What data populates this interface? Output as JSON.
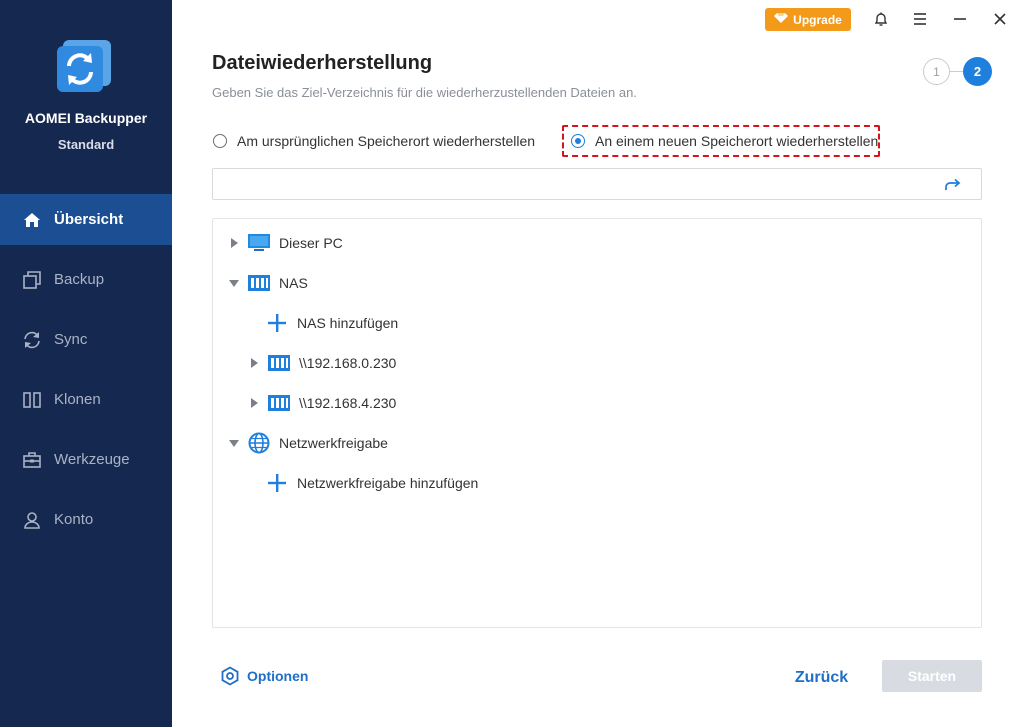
{
  "app": {
    "name": "AOMEI Backupper",
    "edition": "Standard"
  },
  "sidebar": {
    "items": [
      {
        "label": "Übersicht",
        "icon": "home-icon",
        "active": true
      },
      {
        "label": "Backup",
        "icon": "backup-icon",
        "active": false
      },
      {
        "label": "Sync",
        "icon": "sync-icon",
        "active": false
      },
      {
        "label": "Klonen",
        "icon": "clone-icon",
        "active": false
      },
      {
        "label": "Werkzeuge",
        "icon": "toolbox-icon",
        "active": false
      },
      {
        "label": "Konto",
        "icon": "user-icon",
        "active": false
      }
    ]
  },
  "titlebar": {
    "upgrade_label": "Upgrade"
  },
  "header": {
    "title": "Dateiwiederherstellung",
    "subtitle": "Geben Sie das Ziel-Verzeichnis für die wiederherzustellenden Dateien an.",
    "steps": [
      "1",
      "2"
    ],
    "current_step": 2
  },
  "restore_options": {
    "original_label": "Am ursprünglichen Speicherort wiederherstellen",
    "new_label": "An einem neuen Speicherort wiederherstellen",
    "selected": "new"
  },
  "path": {
    "value": "",
    "placeholder": ""
  },
  "tree": {
    "this_pc": "Dieser PC",
    "nas": "NAS",
    "nas_add": "NAS hinzufügen",
    "nas_host_1": "\\\\192.168.0.230",
    "nas_host_2": "\\\\192.168.4.230",
    "network_share": "Netzwerkfreigabe",
    "network_share_add": "Netzwerkfreigabe hinzufügen"
  },
  "footer": {
    "options_label": "Optionen",
    "back_label": "Zurück",
    "start_label": "Starten"
  },
  "colors": {
    "sidebar_bg": "#15284f",
    "sidebar_active": "#1c4e94",
    "accent": "#1f7fdc",
    "upgrade": "#f39a1b",
    "highlight": "#d7141b",
    "disabled": "#d8dce2"
  }
}
